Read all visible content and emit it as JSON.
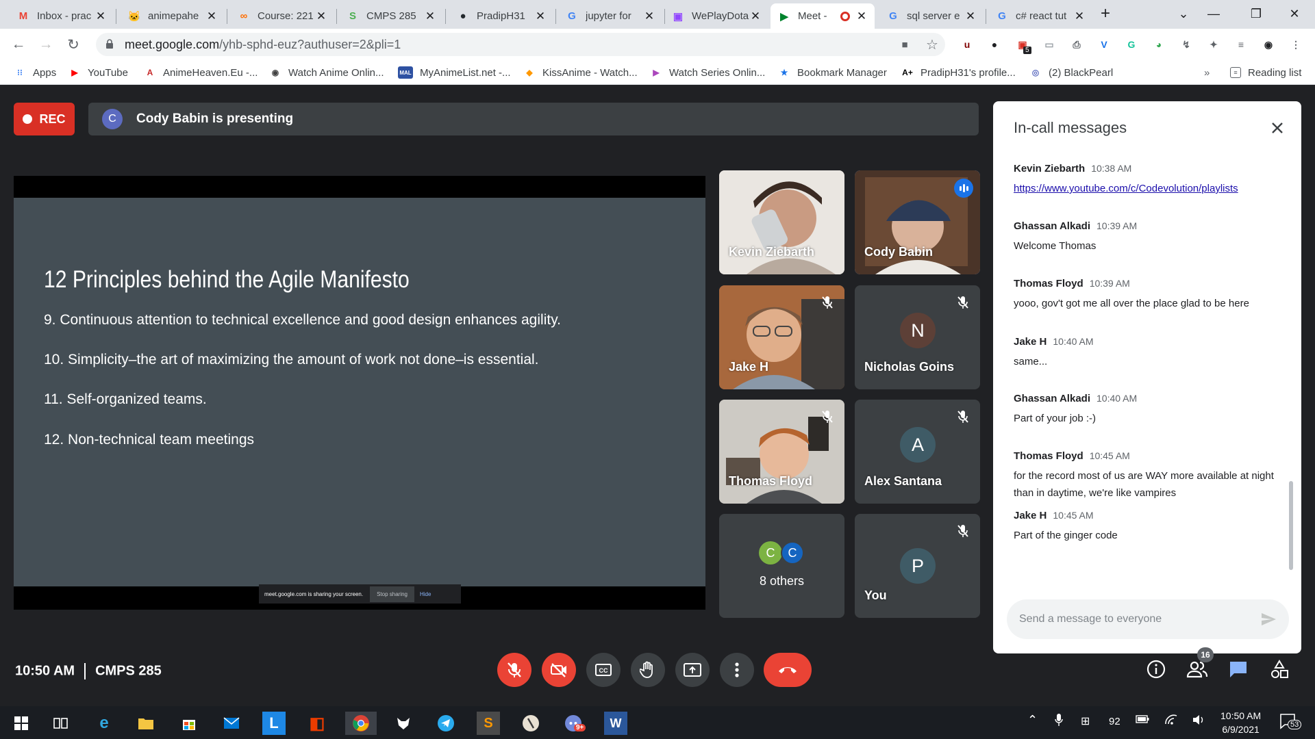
{
  "browser": {
    "tabs": [
      {
        "title": "Inbox - prac",
        "icon": "gmail-icon",
        "glyph": "M",
        "color": "#ea4335"
      },
      {
        "title": "animepahe",
        "icon": "animepahe-icon",
        "glyph": "🐱",
        "color": "#f4b400"
      },
      {
        "title": "Course: 221",
        "icon": "course-icon",
        "glyph": "∞",
        "color": "#ff6d00"
      },
      {
        "title": "CMPS 285",
        "icon": "cmps-icon",
        "glyph": "S",
        "color": "#4caf50"
      },
      {
        "title": "PradipH31",
        "icon": "github-icon",
        "glyph": "●",
        "color": "#24292e"
      },
      {
        "title": "jupyter for",
        "icon": "google-icon",
        "glyph": "G",
        "color": "#4285f4"
      },
      {
        "title": "WePlayDota",
        "icon": "twitch-icon",
        "glyph": "▣",
        "color": "#9146ff"
      },
      {
        "title": "Meet -",
        "icon": "meet-icon",
        "glyph": "▶",
        "color": "#00832d"
      },
      {
        "title": "sql server e",
        "icon": "google-icon",
        "glyph": "G",
        "color": "#4285f4"
      },
      {
        "title": "c# react tut",
        "icon": "google-icon",
        "glyph": "G",
        "color": "#4285f4"
      }
    ],
    "url_host": "meet.google.com",
    "url_path": "/yhb-sphd-euz?authuser=2&pli=1",
    "bookmarks": [
      {
        "label": "Apps",
        "icon": "apps-grid-icon",
        "color": "#4285f4",
        "glyph": "⁝⁝"
      },
      {
        "label": "YouTube",
        "icon": "youtube-icon",
        "color": "#ff0000",
        "glyph": "▶"
      },
      {
        "label": "AnimeHeaven.Eu -...",
        "icon": "animeheaven-icon",
        "color": "#c62828",
        "glyph": "A"
      },
      {
        "label": "Watch Anime Onlin...",
        "icon": "globe-icon",
        "color": "#424242",
        "glyph": "◉"
      },
      {
        "label": "MyAnimeList.net -...",
        "icon": "mal-icon",
        "color": "#2e51a2",
        "glyph": "MAL"
      },
      {
        "label": "KissAnime - Watch...",
        "icon": "kissanime-icon",
        "color": "#ff9800",
        "glyph": "◆"
      },
      {
        "label": "Watch Series Onlin...",
        "icon": "watchseries-icon",
        "color": "#ab47bc",
        "glyph": "▶"
      },
      {
        "label": "Bookmark Manager",
        "icon": "star-icon",
        "color": "#1a73e8",
        "glyph": "★"
      },
      {
        "label": "PradipH31's profile...",
        "icon": "aplus-icon",
        "color": "#000000",
        "glyph": "A+"
      },
      {
        "label": "(2) BlackPearl",
        "icon": "blackpearl-icon",
        "color": "#5c6bc0",
        "glyph": "◎"
      }
    ],
    "reading_list": "Reading list",
    "ext_badge": "5"
  },
  "meet": {
    "rec_label": "REC",
    "presenter_initial": "C",
    "presenter_text": "Cody Babin is presenting",
    "slide": {
      "title": "12 Principles behind the Agile Manifesto",
      "points": [
        "9. Continuous attention to technical excellence and good design enhances agility.",
        "10. Simplicity–the art of maximizing the amount of work not done–is essential.",
        "11. Self-organized teams.",
        "12. Non-technical team meetings"
      ],
      "share_notice": "meet.google.com is sharing your screen.",
      "stop_sharing": "Stop sharing",
      "hide": "Hide"
    },
    "participants": [
      {
        "name": "Kevin Ziebarth",
        "initial": "",
        "video": true,
        "muted": false
      },
      {
        "name": "Cody Babin",
        "initial": "",
        "video": true,
        "muted": false,
        "speaking": true
      },
      {
        "name": "Jake H",
        "initial": "",
        "video": true,
        "muted": true
      },
      {
        "name": "Nicholas Goins",
        "initial": "N",
        "video": false,
        "muted": true
      },
      {
        "name": "Thomas Floyd",
        "initial": "",
        "video": true,
        "muted": true
      },
      {
        "name": "Alex Santana",
        "initial": "A",
        "video": false,
        "muted": true
      },
      {
        "name": "8 others",
        "initial": "",
        "video": false,
        "muted": false
      },
      {
        "name": "You",
        "initial": "P",
        "video": false,
        "muted": true
      }
    ],
    "others_avatars": [
      "C",
      "C"
    ],
    "meeting_time": "10:50 AM",
    "meeting_name": "CMPS 285",
    "people_count": "16",
    "chat": {
      "title": "In-call messages",
      "messages": [
        {
          "sender": "Kevin Ziebarth",
          "time": "10:38 AM",
          "text": "https://www.youtube.com/c/Codevolution/playlists",
          "link": true
        },
        {
          "sender": "Ghassan Alkadi",
          "time": "10:39 AM",
          "text": "Welcome Thomas"
        },
        {
          "sender": "Thomas Floyd",
          "time": "10:39 AM",
          "text": "yooo, gov't got me all over the place glad to be here"
        },
        {
          "sender": "Jake H",
          "time": "10:40 AM",
          "text": "same..."
        },
        {
          "sender": "Ghassan Alkadi",
          "time": "10:40 AM",
          "text": "Part of your job :-)"
        },
        {
          "sender": "Thomas Floyd",
          "time": "10:45 AM",
          "text": "for the record most of us are WAY more available at night than in daytime, we're like vampires"
        },
        {
          "sender": "Jake H",
          "time": "10:45 AM",
          "text": "Part of the ginger code"
        }
      ],
      "placeholder": "Send a message to everyone"
    }
  },
  "taskbar": {
    "battery": "92",
    "time": "10:50 AM",
    "date": "6/9/2021",
    "notifications": "53",
    "word_badge": "9+"
  }
}
